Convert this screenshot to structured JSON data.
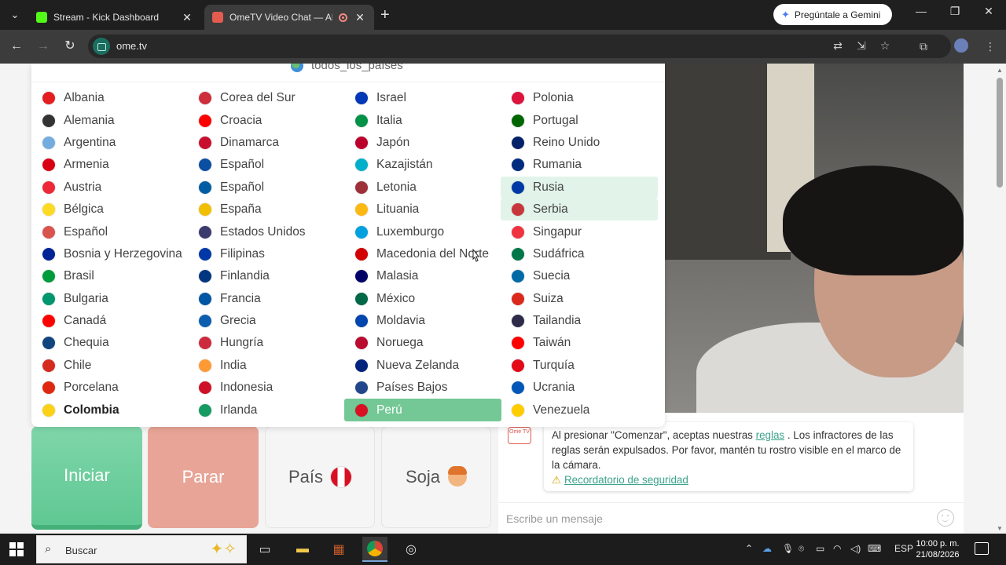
{
  "browser": {
    "tabs": [
      {
        "title": "Stream - Kick Dashboard",
        "favicon_color": "#53fc18"
      },
      {
        "title": "OmeTV Video Chat — Altern",
        "favicon_color": "#e35c4f"
      }
    ],
    "gemini_label": "Pregúntale a Gemini",
    "url": "ome.tv"
  },
  "dropdown": {
    "header": "todos_los_países",
    "columns": [
      [
        {
          "name": "Albania",
          "flag": "#e41e20"
        },
        {
          "name": "Alemania",
          "flag": "#333333"
        },
        {
          "name": "Argentina",
          "flag": "#74acdf"
        },
        {
          "name": "Armenia",
          "flag": "#d90012"
        },
        {
          "name": "Austria",
          "flag": "#ed2939"
        },
        {
          "name": "Bélgica",
          "flag": "#fdda24"
        },
        {
          "name": "Español",
          "flag": "#d9534f"
        },
        {
          "name": "Bosnia y Herzegovina",
          "flag": "#002395"
        },
        {
          "name": "Brasil",
          "flag": "#009c3b"
        },
        {
          "name": "Bulgaria",
          "flag": "#00966e"
        },
        {
          "name": "Canadá",
          "flag": "#ff0000"
        },
        {
          "name": "Chequia",
          "flag": "#11457e"
        },
        {
          "name": "Chile",
          "flag": "#d52b1e"
        },
        {
          "name": "Porcelana",
          "flag": "#de2910"
        },
        {
          "name": "Colombia",
          "flag": "#fcd116",
          "bold": true
        }
      ],
      [
        {
          "name": "Corea del Sur",
          "flag": "#cd2e3a"
        },
        {
          "name": "Croacia",
          "flag": "#ff0000"
        },
        {
          "name": "Dinamarca",
          "flag": "#c8102e"
        },
        {
          "name": "Español",
          "flag": "#0b4ea2"
        },
        {
          "name": "Español",
          "flag": "#005da4"
        },
        {
          "name": "España",
          "flag": "#f1bf00"
        },
        {
          "name": "Estados Unidos",
          "flag": "#3c3b6e"
        },
        {
          "name": "Filipinas",
          "flag": "#0038a8"
        },
        {
          "name": "Finlandia",
          "flag": "#003580"
        },
        {
          "name": "Francia",
          "flag": "#0055a4"
        },
        {
          "name": "Grecia",
          "flag": "#0d5eaf"
        },
        {
          "name": "Hungría",
          "flag": "#cd2a3e"
        },
        {
          "name": "India",
          "flag": "#ff9933"
        },
        {
          "name": "Indonesia",
          "flag": "#ce1126"
        },
        {
          "name": "Irlanda",
          "flag": "#169b62"
        }
      ],
      [
        {
          "name": "Israel",
          "flag": "#0038b8"
        },
        {
          "name": "Italia",
          "flag": "#009246"
        },
        {
          "name": "Japón",
          "flag": "#bc002d"
        },
        {
          "name": "Kazajistán",
          "flag": "#00afca"
        },
        {
          "name": "Letonia",
          "flag": "#9e3039"
        },
        {
          "name": "Lituania",
          "flag": "#fdb913"
        },
        {
          "name": "Luxemburgo",
          "flag": "#00a1de"
        },
        {
          "name": "Macedonia del Norte",
          "flag": "#d20000"
        },
        {
          "name": "Malasia",
          "flag": "#010066"
        },
        {
          "name": "México",
          "flag": "#006847"
        },
        {
          "name": "Moldavia",
          "flag": "#0046ae"
        },
        {
          "name": "Noruega",
          "flag": "#ba0c2f"
        },
        {
          "name": "Nueva Zelanda",
          "flag": "#00247d"
        },
        {
          "name": "Países Bajos",
          "flag": "#21468b"
        },
        {
          "name": "Perú",
          "flag": "#d91023",
          "selected": true
        }
      ],
      [
        {
          "name": "Polonia",
          "flag": "#dc143c"
        },
        {
          "name": "Portugal",
          "flag": "#006600"
        },
        {
          "name": "Reino Unido",
          "flag": "#012169"
        },
        {
          "name": "Rumania",
          "flag": "#002b7f"
        },
        {
          "name": "Rusia",
          "flag": "#0039a6",
          "highlight": true
        },
        {
          "name": "Serbia",
          "flag": "#c6363c",
          "highlight": true
        },
        {
          "name": "Singapur",
          "flag": "#ef3340"
        },
        {
          "name": "Sudáfrica",
          "flag": "#007749"
        },
        {
          "name": "Suecia",
          "flag": "#006aa7"
        },
        {
          "name": "Suiza",
          "flag": "#da291c"
        },
        {
          "name": "Tailandia",
          "flag": "#2d2a4a"
        },
        {
          "name": "Taiwán",
          "flag": "#fe0000"
        },
        {
          "name": "Turquía",
          "flag": "#e30a17"
        },
        {
          "name": "Ucrania",
          "flag": "#0057b7"
        },
        {
          "name": "Venezuela",
          "flag": "#ffcc00"
        }
      ]
    ]
  },
  "controls": {
    "start_label": "Iniciar",
    "stop_label": "Parar",
    "country_label": "País",
    "gender_label": "Soja"
  },
  "chat": {
    "logo_text": "Ome TV",
    "notice_before": "Al presionar \"Comenzar\", aceptas nuestras",
    "rules_link": "reglas",
    "notice_after": ". Los infractores de las reglas serán expulsados. Por favor, mantén tu rostro visible en el marco de la cámara.",
    "safety_link": "Recordatorio de seguridad",
    "input_placeholder": "Escribe un mensaje"
  },
  "taskbar": {
    "search_placeholder": "Buscar",
    "language": "ESP",
    "time": "10:00 p. m.",
    "date": "21/08/2026"
  }
}
